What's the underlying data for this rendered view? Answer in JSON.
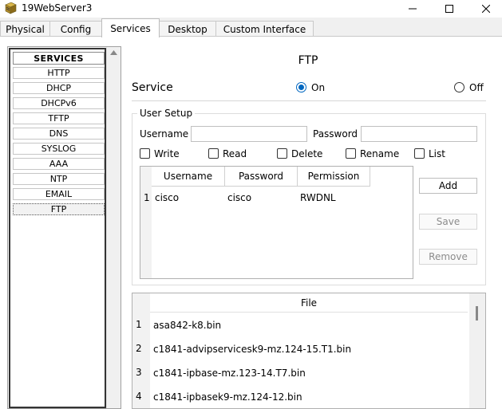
{
  "window": {
    "title": "19WebServer3",
    "icon": "server-icon"
  },
  "tabs": [
    {
      "label": "Physical"
    },
    {
      "label": "Config"
    },
    {
      "label": "Services"
    },
    {
      "label": "Desktop"
    },
    {
      "label": "Custom Interface"
    }
  ],
  "active_tab": "Services",
  "services": {
    "header": "SERVICES",
    "items": [
      "HTTP",
      "DHCP",
      "DHCPv6",
      "TFTP",
      "DNS",
      "SYSLOG",
      "AAA",
      "NTP",
      "EMAIL",
      "FTP"
    ],
    "selected": "FTP"
  },
  "ftp": {
    "title": "FTP",
    "service_label": "Service",
    "on_label": "On",
    "off_label": "Off",
    "service_state": "On",
    "user_setup": {
      "group_label": "User Setup",
      "username_label": "Username",
      "username_value": "",
      "password_label": "Password",
      "password_value": "",
      "permissions": [
        {
          "label": "Write",
          "checked": false
        },
        {
          "label": "Read",
          "checked": false
        },
        {
          "label": "Delete",
          "checked": false
        },
        {
          "label": "Rename",
          "checked": false
        },
        {
          "label": "List",
          "checked": false
        }
      ],
      "table": {
        "columns": [
          "Username",
          "Password",
          "Permission"
        ],
        "rows": [
          {
            "index": "1",
            "username": "cisco",
            "password": "cisco",
            "permission": "RWDNL"
          }
        ]
      },
      "buttons": {
        "add": "Add",
        "save": "Save",
        "remove": "Remove"
      }
    },
    "files": {
      "header": "File",
      "items": [
        {
          "index": "1",
          "name": "asa842-k8.bin"
        },
        {
          "index": "2",
          "name": "c1841-advipservicesk9-mz.124-15.T1.bin"
        },
        {
          "index": "3",
          "name": "c1841-ipbase-mz.123-14.T7.bin"
        },
        {
          "index": "4",
          "name": "c1841-ipbasek9-mz.124-12.bin"
        }
      ]
    }
  },
  "colors": {
    "accent": "#0067c0"
  }
}
